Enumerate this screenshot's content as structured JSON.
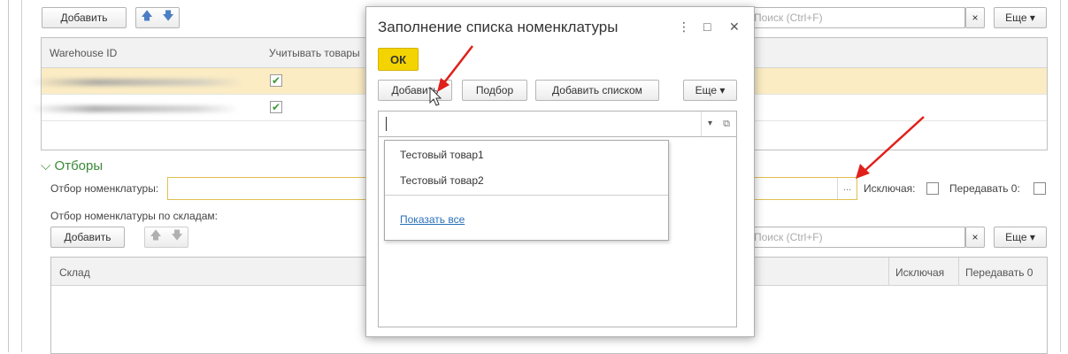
{
  "top_toolbar": {
    "add_label": "Добавить",
    "search_placeholder": "Поиск (Ctrl+F)",
    "clear_label": "×",
    "more_label": "Еще ▾"
  },
  "warehouse_grid": {
    "columns": [
      "Warehouse ID",
      "Учитывать товары"
    ],
    "rows": [
      {
        "checked": true,
        "selected": true
      },
      {
        "checked": true,
        "selected": false
      }
    ]
  },
  "filters": {
    "group_title": "Отборы",
    "nomenclature_label": "Отбор номенклатуры:",
    "picker_label": "...",
    "exclude_label": "Исключая:",
    "transfer_zero_label": "Передавать 0:",
    "by_warehouse_label": "Отбор номенклатуры по складам:",
    "add_label": "Добавить",
    "search_placeholder": "Поиск (Ctrl+F)",
    "clear_label": "×",
    "more_label": "Еще ▾"
  },
  "bottom_grid": {
    "columns": [
      "Склад",
      "Исключая",
      "Передавать 0"
    ]
  },
  "dialog": {
    "title": "Заполнение списка номенклатуры",
    "menu_icon": "⋮",
    "maximize_icon": "□",
    "close_icon": "✕",
    "ok_label": "ОК",
    "add_label": "Добавить",
    "select_label": "Подбор",
    "add_list_label": "Добавить списком",
    "more_label": "Еще ▾",
    "dropdown_arrow": "▾",
    "open_icon": "⧉",
    "suggestions": [
      "Тестовый товар1",
      "Тестовый товар2"
    ],
    "show_all_label": "Показать все"
  },
  "colors": {
    "ok_button": "#f4d400",
    "selected_row": "#fbecc4",
    "group_title": "#3a8a3a",
    "annotation_arrow": "#e0201a",
    "link": "#2a6fb8"
  }
}
